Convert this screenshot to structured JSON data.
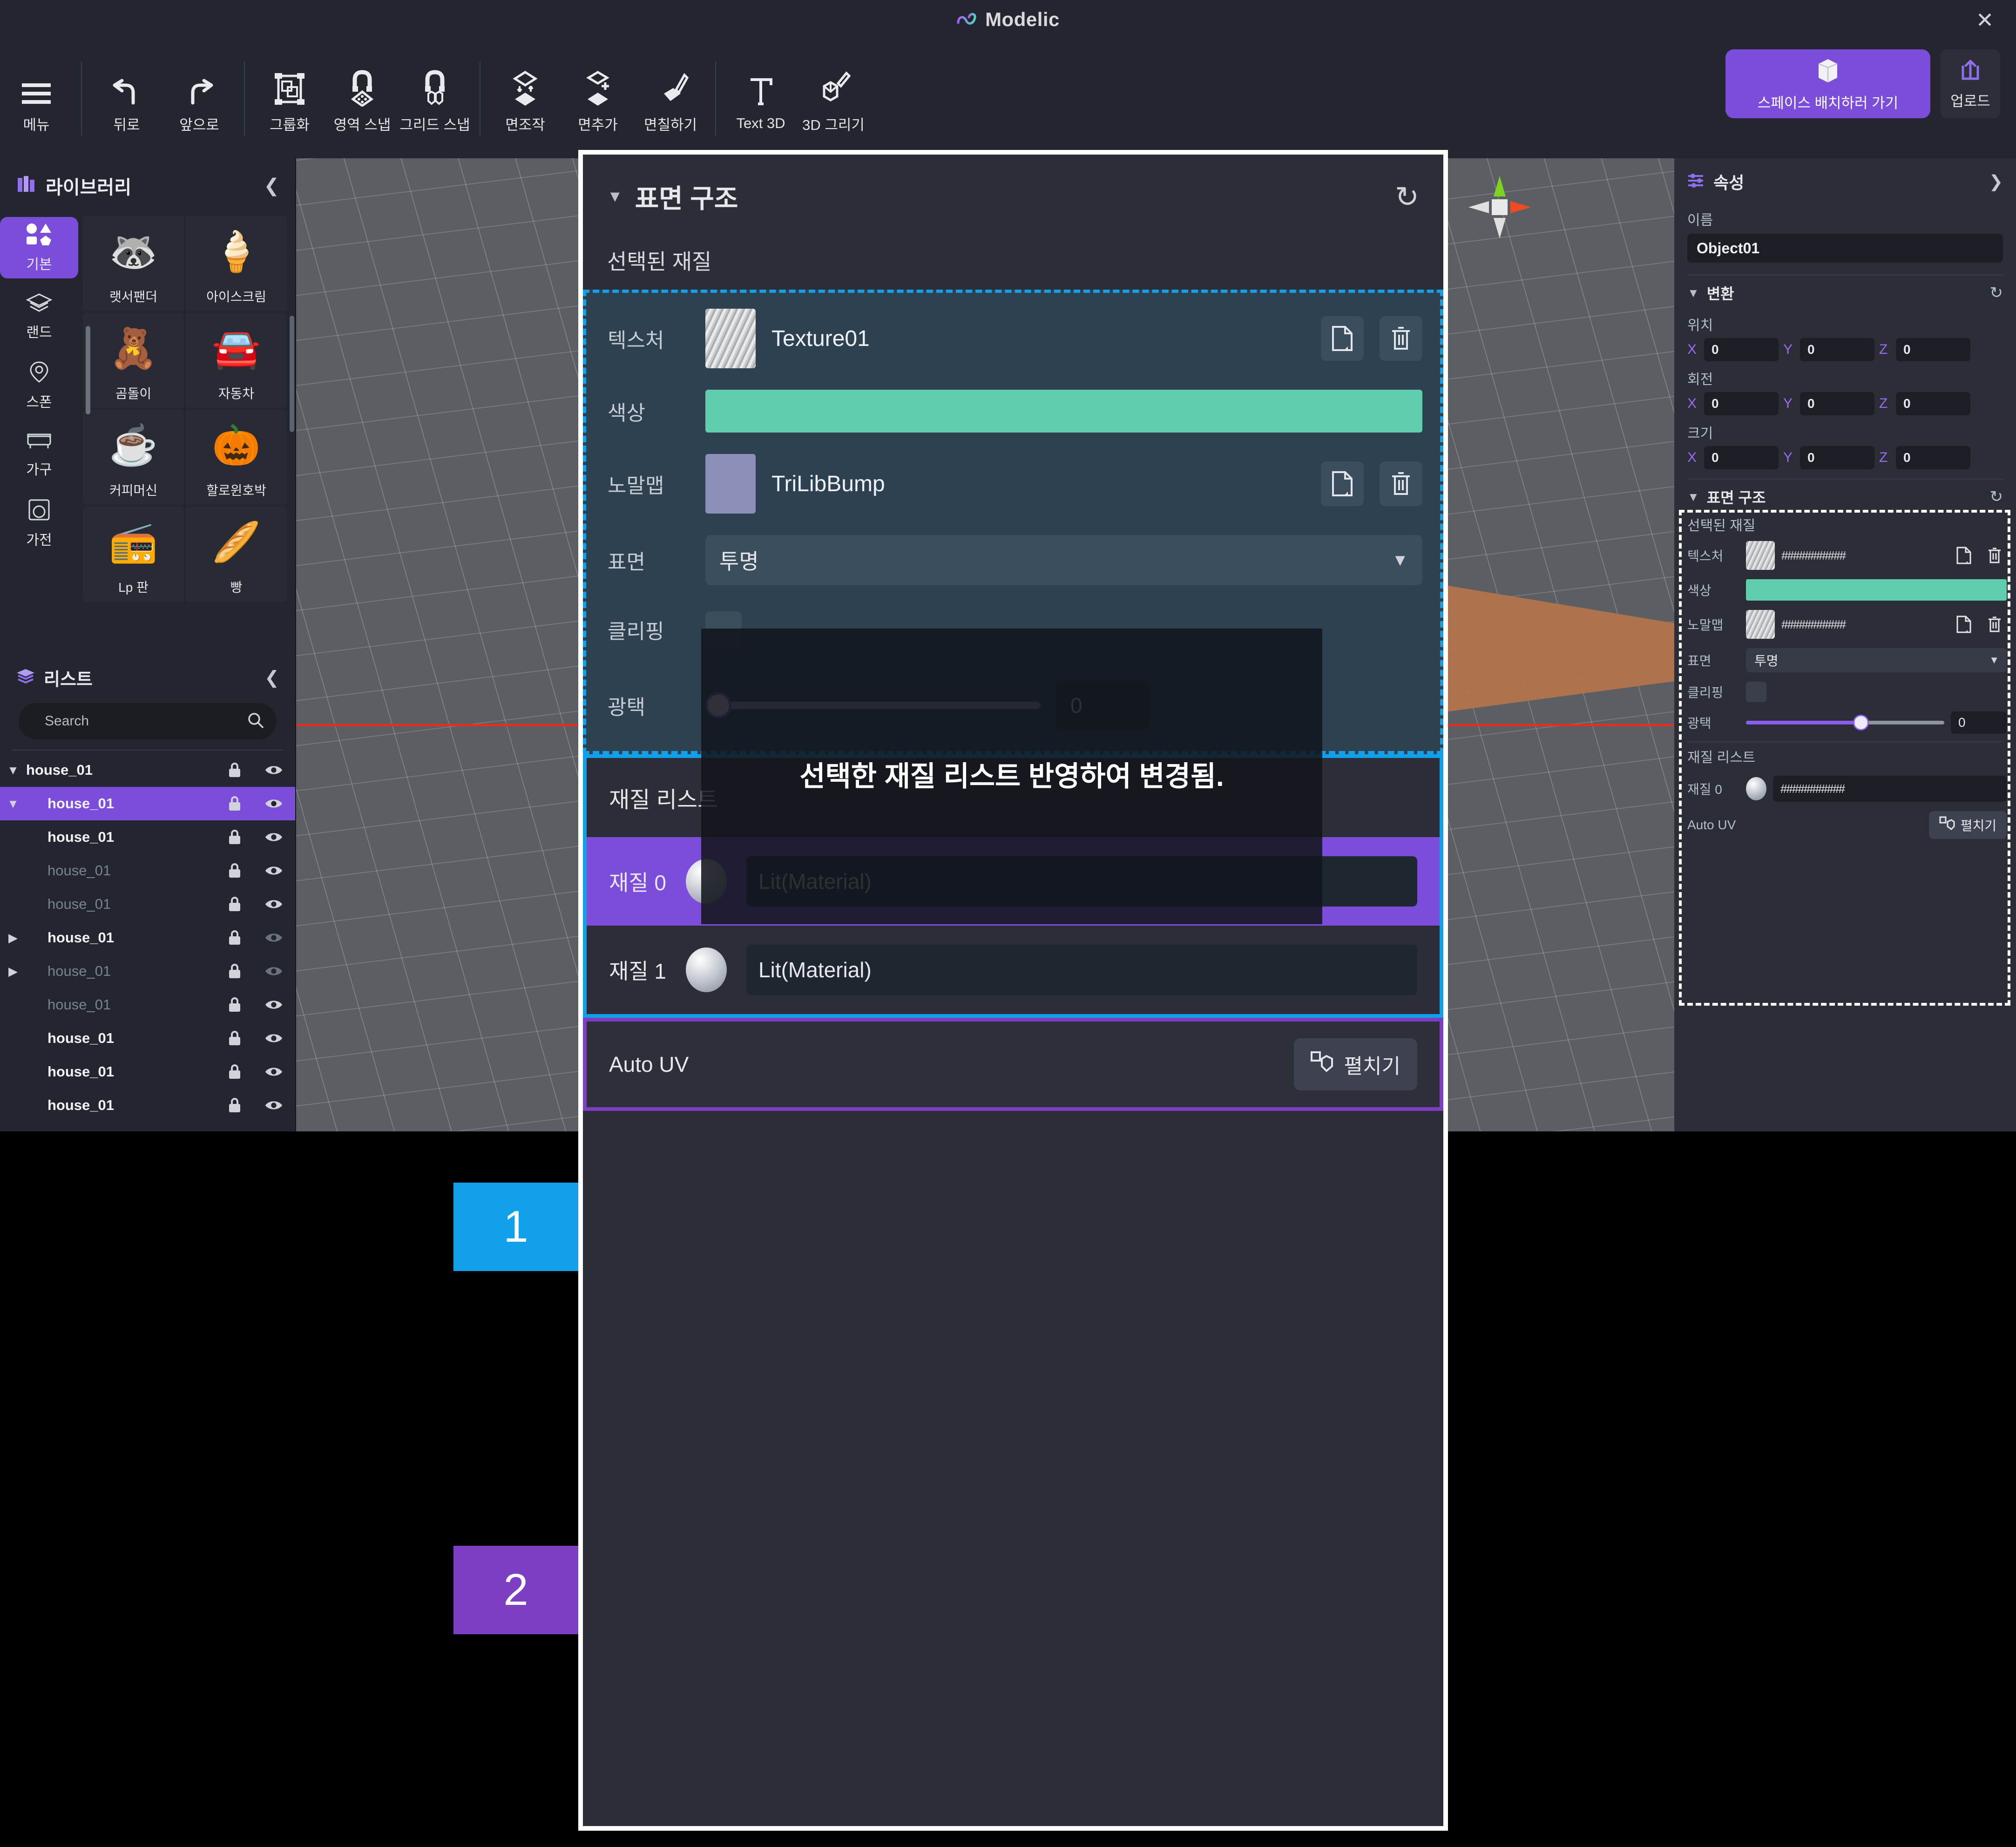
{
  "app": {
    "title": "Modelic",
    "close_label": "✕"
  },
  "toolbar": {
    "groups": [
      {
        "items": [
          {
            "label": "메뉴",
            "icon": "hamburger-menu-icon"
          }
        ]
      },
      {
        "items": [
          {
            "label": "뒤로",
            "icon": "undo-icon"
          },
          {
            "label": "앞으로",
            "icon": "redo-icon"
          }
        ]
      },
      {
        "items": [
          {
            "label": "그룹화",
            "icon": "group-icon"
          },
          {
            "label": "영역 스냅",
            "icon": "area-snap-icon"
          },
          {
            "label": "그리드 스냅",
            "icon": "grid-snap-icon"
          }
        ]
      },
      {
        "items": [
          {
            "label": "면조작",
            "icon": "face-manipulate-icon"
          },
          {
            "label": "면추가",
            "icon": "face-add-icon"
          },
          {
            "label": "면칠하기",
            "icon": "face-paint-icon"
          }
        ]
      },
      {
        "items": [
          {
            "label": "Text 3D",
            "icon": "text-3d-icon"
          },
          {
            "label": "3D 그리기",
            "icon": "draw-3d-icon"
          }
        ]
      }
    ],
    "space_button": {
      "label": "스페이스 배치하러 가기",
      "icon": "cube-icon",
      "color": "#7c4ddb"
    },
    "upload_button": {
      "label": "업로드",
      "icon": "upload-icon"
    }
  },
  "library": {
    "title": "라이브러리",
    "collapse_icon": "chevron-left-icon",
    "categories": [
      {
        "label": "기본",
        "icon": "shapes-icon",
        "active": true
      },
      {
        "label": "랜드",
        "icon": "layers-icon",
        "active": false
      },
      {
        "label": "스폰",
        "icon": "pin-icon",
        "active": false
      },
      {
        "label": "가구",
        "icon": "sofa-icon",
        "active": false
      },
      {
        "label": "가전",
        "icon": "washer-icon",
        "active": false
      }
    ],
    "assets": [
      {
        "label": "랫서팬더",
        "glyph": "🦝"
      },
      {
        "label": "아이스크림",
        "glyph": "🍦"
      },
      {
        "label": "곰돌이",
        "glyph": "🧸"
      },
      {
        "label": "자동차",
        "glyph": "🚘"
      },
      {
        "label": "커피머신",
        "glyph": "☕"
      },
      {
        "label": "할로윈호박",
        "glyph": "🎃"
      },
      {
        "label": "Lp 판",
        "glyph": "📻"
      },
      {
        "label": "빵",
        "glyph": "🥖"
      }
    ]
  },
  "object_list": {
    "title": "리스트",
    "collapse_icon": "chevron-left-icon",
    "search": {
      "placeholder": "Search",
      "value": "",
      "icon": "search-icon"
    },
    "rows": [
      {
        "name": "house_01",
        "indent": 0,
        "twisty": "down",
        "selected": false,
        "dim": false,
        "lock": "lock-icon",
        "eye": "eye-icon",
        "eye_dim": false
      },
      {
        "name": "house_01",
        "indent": 1,
        "twisty": "down",
        "selected": true,
        "dim": false,
        "lock": "lock-icon",
        "eye": "eye-icon",
        "eye_dim": false
      },
      {
        "name": "house_01",
        "indent": 1,
        "twisty": "",
        "selected": false,
        "dim": false,
        "lock": "lock-icon",
        "eye": "eye-icon",
        "eye_dim": false
      },
      {
        "name": "house_01",
        "indent": 1,
        "twisty": "",
        "selected": false,
        "dim": true,
        "lock": "lock-icon",
        "eye": "eye-icon",
        "eye_dim": false
      },
      {
        "name": "house_01",
        "indent": 1,
        "twisty": "",
        "selected": false,
        "dim": true,
        "lock": "lock-icon",
        "eye": "eye-icon",
        "eye_dim": false
      },
      {
        "name": "house_01",
        "indent": 1,
        "twisty": "right",
        "selected": false,
        "dim": false,
        "lock": "lock-icon",
        "eye": "eye-icon",
        "eye_dim": true
      },
      {
        "name": "house_01",
        "indent": 1,
        "twisty": "right",
        "selected": false,
        "dim": true,
        "lock": "lock-icon",
        "eye": "eye-icon",
        "eye_dim": true
      },
      {
        "name": "house_01",
        "indent": 1,
        "twisty": "",
        "selected": false,
        "dim": true,
        "lock": "lock-icon",
        "eye": "eye-icon",
        "eye_dim": false
      },
      {
        "name": "house_01",
        "indent": 1,
        "twisty": "",
        "selected": false,
        "dim": false,
        "lock": "lock-icon",
        "eye": "eye-icon",
        "eye_dim": false
      },
      {
        "name": "house_01",
        "indent": 1,
        "twisty": "",
        "selected": false,
        "dim": false,
        "lock": "lock-icon",
        "eye": "eye-icon",
        "eye_dim": false
      },
      {
        "name": "house_01",
        "indent": 1,
        "twisty": "",
        "selected": false,
        "dim": false,
        "lock": "lock-icon",
        "eye": "eye-icon",
        "eye_dim": false
      }
    ]
  },
  "viewport": {
    "gizmo": {
      "x_color": "#f04a22",
      "y_color": "#7ed321",
      "neutral_color": "#e8e8e8"
    },
    "axis_color": "#e03020",
    "object_color": "#b5744a",
    "grid_color": "#8d9097"
  },
  "properties": {
    "title": "속성",
    "expand_icon": "chevron-right-icon",
    "name_label": "이름",
    "name_value": "Object01",
    "transform": {
      "title": "변환",
      "reset_icon": "refresh-icon",
      "position": {
        "label": "위치",
        "x": "0",
        "y": "0",
        "z": "0"
      },
      "rotation": {
        "label": "회전",
        "x": "0",
        "y": "0",
        "z": "0"
      },
      "scale": {
        "label": "크기",
        "x": "0",
        "y": "0",
        "z": "0"
      }
    },
    "surface": {
      "title": "표면 구조",
      "reset_icon": "refresh-icon",
      "selected_material_label": "선택된 재질",
      "texture_label": "텍스처",
      "texture_value": "###########",
      "color_label": "색상",
      "color_value": "#5fcdae",
      "normal_label": "노말맵",
      "normal_value": "###########",
      "surface_label": "표면",
      "surface_value": "투명",
      "clipping_label": "클리핑",
      "gloss_label": "광택",
      "gloss_value": "0",
      "open_icon": "file-open-icon",
      "delete_icon": "trash-icon",
      "material_list_label": "재질 리스트",
      "material_0_label": "재질 0",
      "material_0_value": "###########",
      "auto_uv_label": "Auto UV",
      "unwrap_button": "펼치기",
      "unwrap_icon": "unwrap-icon"
    }
  },
  "dialog": {
    "title": "표면 구조",
    "collapse_icon": "triangle-down-icon",
    "reset_icon": "refresh-icon",
    "selected_material_label": "선택된 재질",
    "texture_label": "텍스처",
    "texture_value": "Texture01",
    "color_label": "색상",
    "color_value": "#5fcdae",
    "normal_label": "노말맵",
    "normal_value": "TriLibBump",
    "surface_label": "표면",
    "surface_value": "투명",
    "clipping_label": "클리핑",
    "gloss_label": "광택",
    "gloss_value": "0",
    "open_icon": "file-open-icon",
    "delete_icon": "trash-icon",
    "material_list": {
      "title": "재질 리스트",
      "rows": [
        {
          "key": "재질 0",
          "value": "Lit(Material)",
          "selected": true
        },
        {
          "key": "재질 1",
          "value": "Lit(Material)",
          "selected": false
        }
      ]
    },
    "auto_uv": {
      "label": "Auto UV",
      "button": "펼치기",
      "icon": "unwrap-icon"
    },
    "note_overlay": "선택한 재질 리스트 반영하여 변경됨."
  },
  "callouts": [
    {
      "number": "1",
      "color": "#12a0e8"
    },
    {
      "number": "2",
      "color": "#7c3fc4"
    }
  ]
}
